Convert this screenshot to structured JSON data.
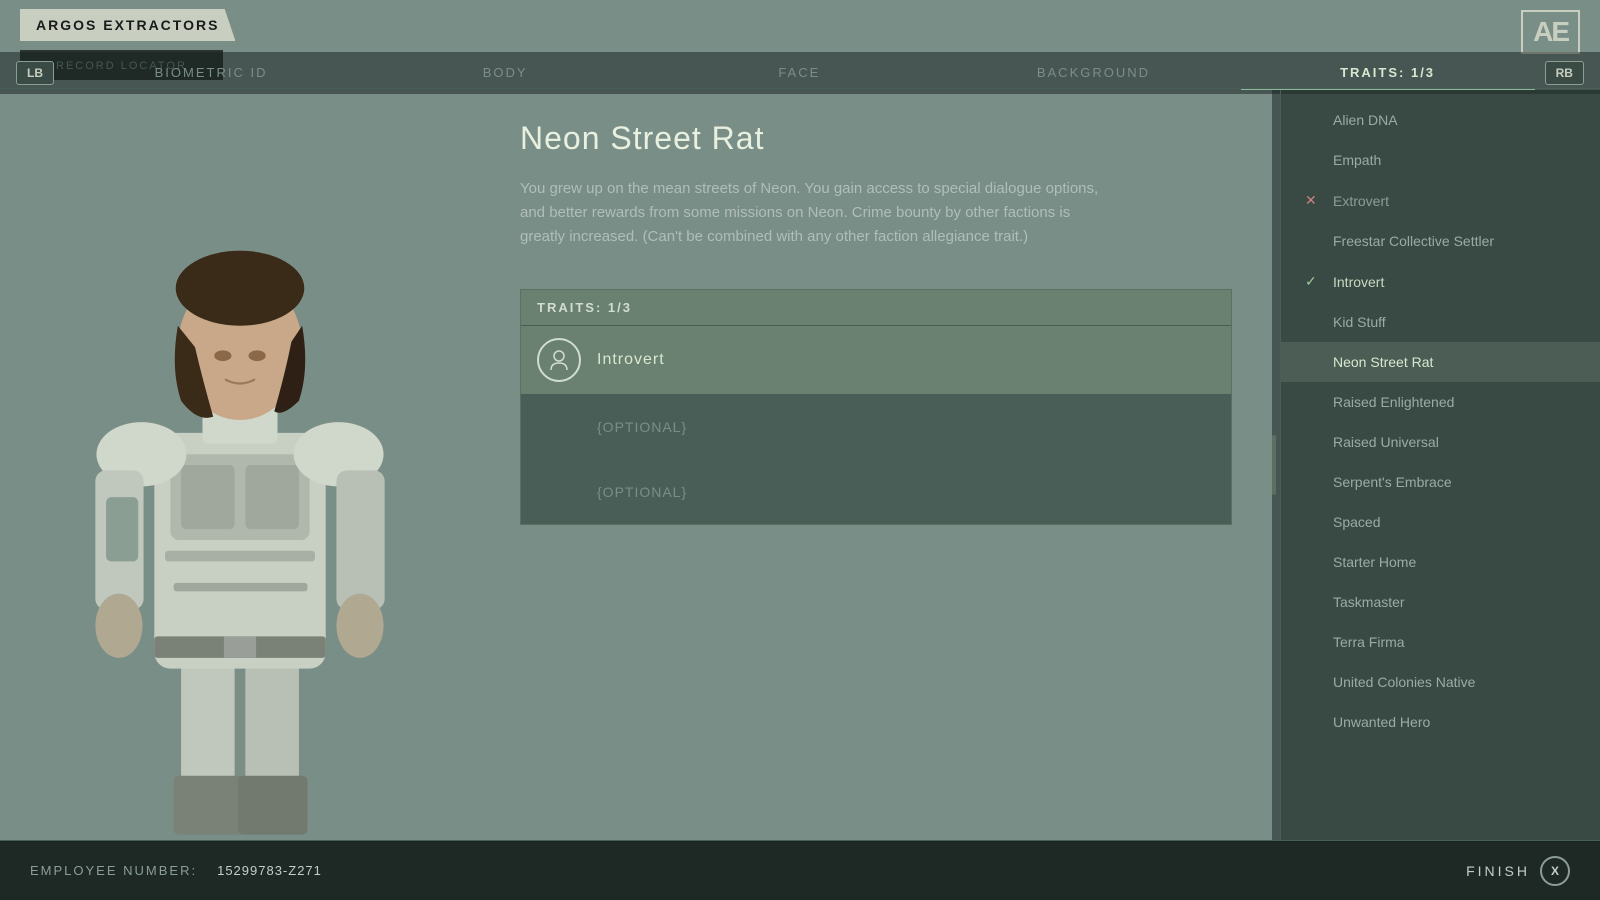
{
  "header": {
    "brand": "ARGOS EXTRACTORS",
    "subtitle": "RECORD LOCATOR",
    "logo": "AE"
  },
  "nav": {
    "lb_label": "LB",
    "rb_label": "RB",
    "tabs": [
      {
        "label": "BIOMETRIC ID"
      },
      {
        "label": "BODY"
      },
      {
        "label": "FACE"
      },
      {
        "label": "BACKGROUND"
      },
      {
        "label": "TRAITS: 1/3",
        "active": true
      }
    ]
  },
  "selected_trait": {
    "name": "Neon Street Rat",
    "description": "You grew up on the mean streets of Neon. You gain access to special dialogue options, and better rewards from some missions on Neon. Crime bounty by other factions is greatly increased. (Can't be combined with any other faction allegiance trait.)"
  },
  "traits_summary": {
    "label": "TRAITS: 1/3",
    "slot1": {
      "name": "Introvert",
      "has_icon": true
    },
    "slot2": "{OPTIONAL}",
    "slot3": "{OPTIONAL}"
  },
  "trait_list": {
    "items": [
      {
        "label": "Alien DNA",
        "marker": "",
        "state": "normal"
      },
      {
        "label": "Empath",
        "marker": "",
        "state": "normal"
      },
      {
        "label": "Extrovert",
        "marker": "x",
        "state": "excluded"
      },
      {
        "label": "Freestar Collective Settler",
        "marker": "",
        "state": "normal"
      },
      {
        "label": "Introvert",
        "marker": "check",
        "state": "selected"
      },
      {
        "label": "Kid Stuff",
        "marker": "",
        "state": "normal"
      },
      {
        "label": "Neon Street Rat",
        "marker": "",
        "state": "highlighted"
      },
      {
        "label": "Raised Enlightened",
        "marker": "",
        "state": "normal"
      },
      {
        "label": "Raised Universal",
        "marker": "",
        "state": "normal"
      },
      {
        "label": "Serpent's Embrace",
        "marker": "",
        "state": "normal"
      },
      {
        "label": "Spaced",
        "marker": "",
        "state": "normal"
      },
      {
        "label": "Starter Home",
        "marker": "",
        "state": "normal"
      },
      {
        "label": "Taskmaster",
        "marker": "",
        "state": "normal"
      },
      {
        "label": "Terra Firma",
        "marker": "",
        "state": "normal"
      },
      {
        "label": "United Colonies Native",
        "marker": "",
        "state": "normal"
      },
      {
        "label": "Unwanted Hero",
        "marker": "",
        "state": "normal"
      }
    ]
  },
  "footer": {
    "employee_label": "EMPLOYEE NUMBER:",
    "employee_number": "15299783-Z271",
    "finish_label": "FINISH",
    "finish_button": "X"
  }
}
